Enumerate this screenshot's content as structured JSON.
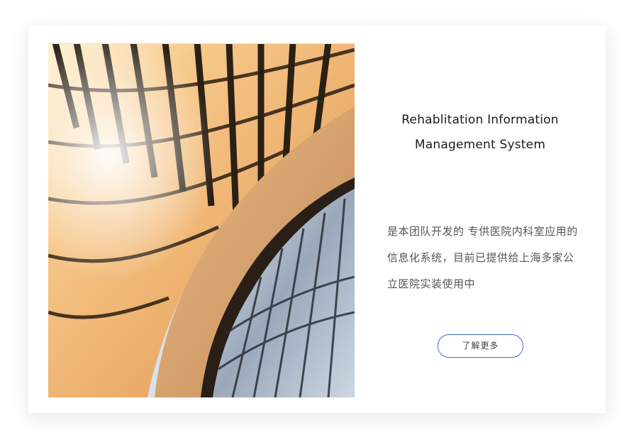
{
  "title_line1": "Rehablitation Information",
  "title_line2": "Management System",
  "description": "是本团队开发的 专供医院内科室应用的信息化系统，目前已提供给上海多家公立医院实装使用中",
  "more_button_label": "了解更多",
  "accent_color": "#3f6bd6"
}
